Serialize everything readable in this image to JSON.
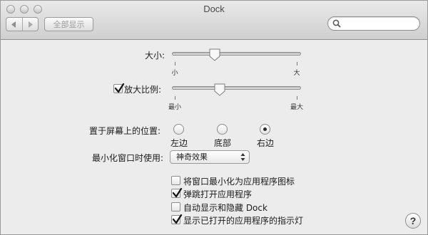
{
  "window": {
    "title": "Dock"
  },
  "toolbar": {
    "back_icon": "chevron-left-icon",
    "forward_icon": "chevron-right-icon",
    "show_all_label": "全部显示",
    "search": {
      "value": "",
      "placeholder": ""
    }
  },
  "size": {
    "label": "大小:",
    "min_label": "小",
    "max_label": "大",
    "value_fraction": 0.34
  },
  "magnification": {
    "label": "放大比例:",
    "checked": true,
    "min_label": "最小",
    "max_label": "最大",
    "value_fraction": 0.38
  },
  "position": {
    "label": "置于屏幕上的位置:",
    "options": [
      {
        "label": "左边",
        "selected": false
      },
      {
        "label": "底部",
        "selected": false
      },
      {
        "label": "右边",
        "selected": true
      }
    ]
  },
  "minimize": {
    "label": "最小化窗口时使用:",
    "selected": "神奇效果"
  },
  "checkboxes": [
    {
      "label": "将窗口最小化为应用程序图标",
      "checked": false
    },
    {
      "label": "弹跳打开应用程序",
      "checked": true
    },
    {
      "label": "自动显示和隐藏 Dock",
      "checked": false
    },
    {
      "label": "显示已打开的应用程序的指示灯",
      "checked": true
    }
  ],
  "help": {
    "label": "?"
  }
}
